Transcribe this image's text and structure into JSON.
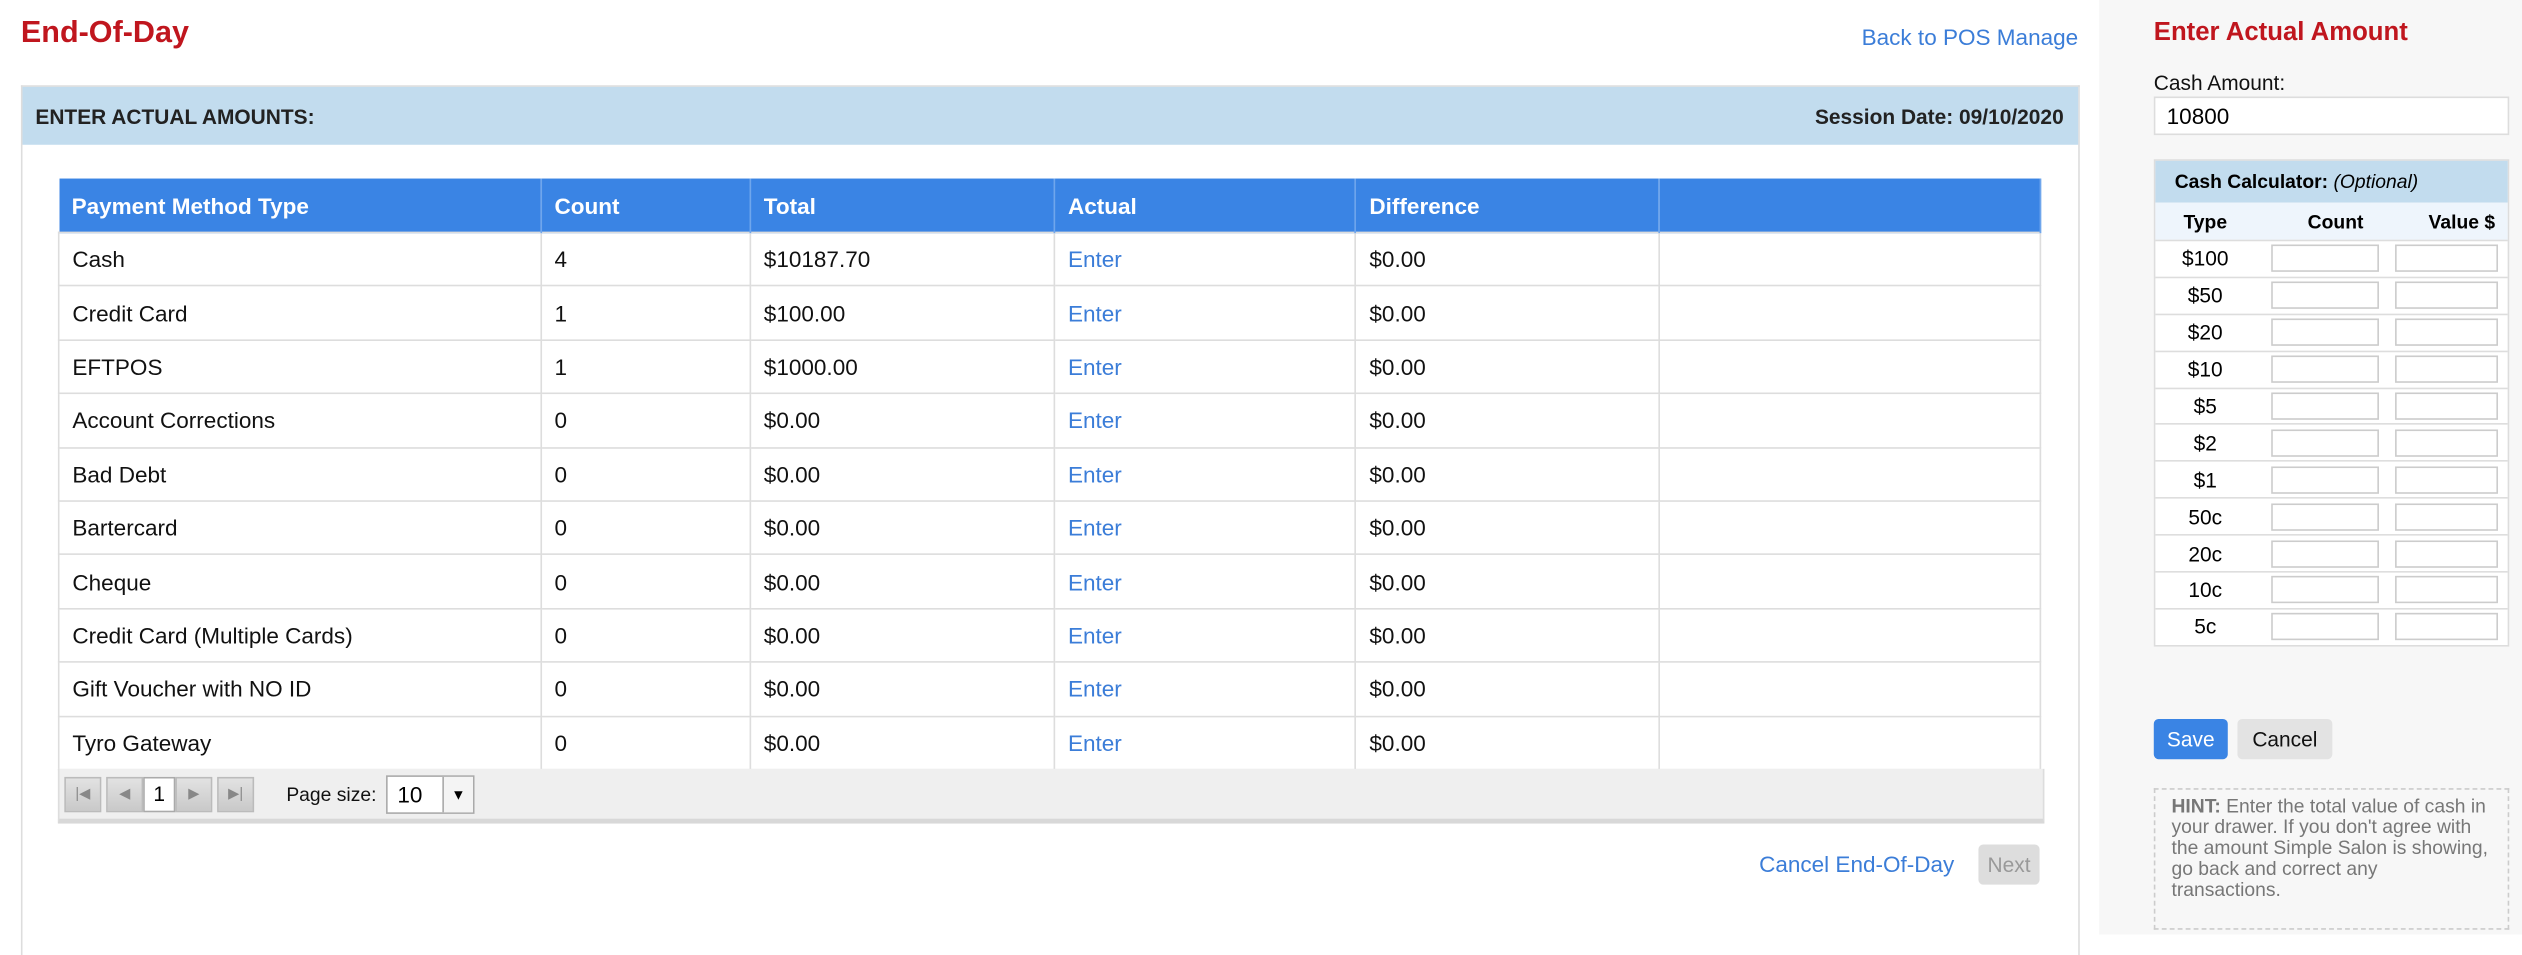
{
  "page": {
    "title": "End-Of-Day",
    "back_link": "Back to POS Manage"
  },
  "panel": {
    "heading": "ENTER ACTUAL AMOUNTS:",
    "session_date": "Session Date: 09/10/2020"
  },
  "table": {
    "columns": [
      "Payment Method Type",
      "Count",
      "Total",
      "Actual",
      "Difference",
      ""
    ],
    "rows": [
      {
        "type": "Cash",
        "count": "4",
        "total": "$10187.70",
        "actual": "Enter",
        "difference": "$0.00"
      },
      {
        "type": "Credit Card",
        "count": "1",
        "total": "$100.00",
        "actual": "Enter",
        "difference": "$0.00"
      },
      {
        "type": "EFTPOS",
        "count": "1",
        "total": "$1000.00",
        "actual": "Enter",
        "difference": "$0.00"
      },
      {
        "type": "Account Corrections",
        "count": "0",
        "total": "$0.00",
        "actual": "Enter",
        "difference": "$0.00"
      },
      {
        "type": "Bad Debt",
        "count": "0",
        "total": "$0.00",
        "actual": "Enter",
        "difference": "$0.00"
      },
      {
        "type": "Bartercard",
        "count": "0",
        "total": "$0.00",
        "actual": "Enter",
        "difference": "$0.00"
      },
      {
        "type": "Cheque",
        "count": "0",
        "total": "$0.00",
        "actual": "Enter",
        "difference": "$0.00"
      },
      {
        "type": "Credit Card (Multiple Cards)",
        "count": "0",
        "total": "$0.00",
        "actual": "Enter",
        "difference": "$0.00"
      },
      {
        "type": "Gift Voucher with NO ID",
        "count": "0",
        "total": "$0.00",
        "actual": "Enter",
        "difference": "$0.00"
      },
      {
        "type": "Tyro Gateway",
        "count": "0",
        "total": "$0.00",
        "actual": "Enter",
        "difference": "$0.00"
      }
    ]
  },
  "pager": {
    "current_page": "1",
    "page_size_label": "Page size:",
    "page_size": "10"
  },
  "footer": {
    "cancel_label": "Cancel End-Of-Day",
    "next_label": "Next"
  },
  "sidebar": {
    "title": "Enter Actual Amount",
    "cash_label": "Cash Amount:",
    "cash_value": "10800",
    "calc_title": "Cash Calculator:",
    "calc_optional": "(Optional)",
    "calc_columns": [
      "Type",
      "Count",
      "Value $"
    ],
    "denominations": [
      "$100",
      "$50",
      "$20",
      "$10",
      "$5",
      "$2",
      "$1",
      "50c",
      "20c",
      "10c",
      "5c"
    ],
    "save_label": "Save",
    "cancel_label": "Cancel",
    "hint_label": "HINT:",
    "hint_text": " Enter the total value of cash in your drawer. If you don't agree with the amount Simple Salon is showing, go back and correct any transactions."
  },
  "colors": {
    "brand_red": "#c0161e",
    "link_blue": "#3b7dd8",
    "header_blue": "#3a84e4",
    "panel_blue": "#c2dcee"
  }
}
